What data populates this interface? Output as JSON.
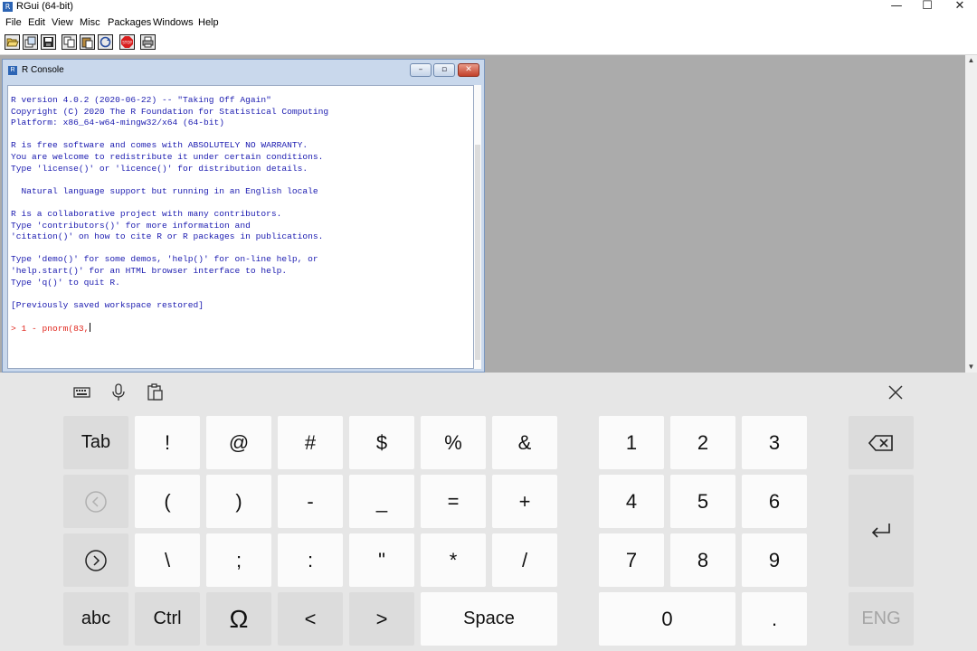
{
  "app": {
    "title": "RGui (64-bit)",
    "icon": "r-logo-icon",
    "controls": {
      "minimize": "—",
      "maximize": "☐",
      "close": "✕"
    }
  },
  "menu": [
    "File",
    "Edit",
    "View",
    "Misc",
    "Packages",
    "Windows",
    "Help"
  ],
  "toolbar": {
    "buttons": [
      "open-script-icon",
      "load-workspace-icon",
      "save-workspace-icon",
      "copy-icon",
      "paste-icon",
      "copy-paste-icon",
      "stop-icon",
      "print-icon"
    ]
  },
  "console_window": {
    "title": "R Console",
    "lines": [
      "R version 4.0.2 (2020-06-22) -- \"Taking Off Again\"",
      "Copyright (C) 2020 The R Foundation for Statistical Computing",
      "Platform: x86_64-w64-mingw32/x64 (64-bit)",
      "",
      "R is free software and comes with ABSOLUTELY NO WARRANTY.",
      "You are welcome to redistribute it under certain conditions.",
      "Type 'license()' or 'licence()' for distribution details.",
      "",
      "  Natural language support but running in an English locale",
      "",
      "R is a collaborative project with many contributors.",
      "Type 'contributors()' for more information and",
      "'citation()' on how to cite R or R packages in publications.",
      "",
      "Type 'demo()' for some demos, 'help()' for on-line help, or",
      "'help.start()' for an HTML browser interface to help.",
      "Type 'q()' to quit R.",
      "",
      "[Previously saved workspace restored]",
      ""
    ],
    "input_line": "> 1 - pnorm(83,",
    "text_color": "#1b1bb0",
    "input_color": "#e0241b"
  },
  "keyboard": {
    "tools": [
      "keyboard-settings-icon",
      "microphone-icon",
      "clipboard-icon",
      "close-icon"
    ],
    "row1": [
      "Tab",
      "!",
      "@",
      "#",
      "$",
      "%",
      "&",
      "1",
      "2",
      "3"
    ],
    "row2": [
      "(",
      ")",
      "-",
      "_",
      "=",
      "+",
      "4",
      "5",
      "6"
    ],
    "row3": [
      "\\",
      ";",
      ":",
      "\"",
      "*",
      "/",
      "7",
      "8",
      "9"
    ],
    "row4": [
      "abc",
      "Ctrl",
      "Ω",
      "<",
      ">",
      "Space",
      "0",
      ".",
      "ENG"
    ],
    "icon_keys": [
      "backspace-icon",
      "enter-icon",
      "left-arrow-circle-icon",
      "right-arrow-circle-icon"
    ]
  }
}
